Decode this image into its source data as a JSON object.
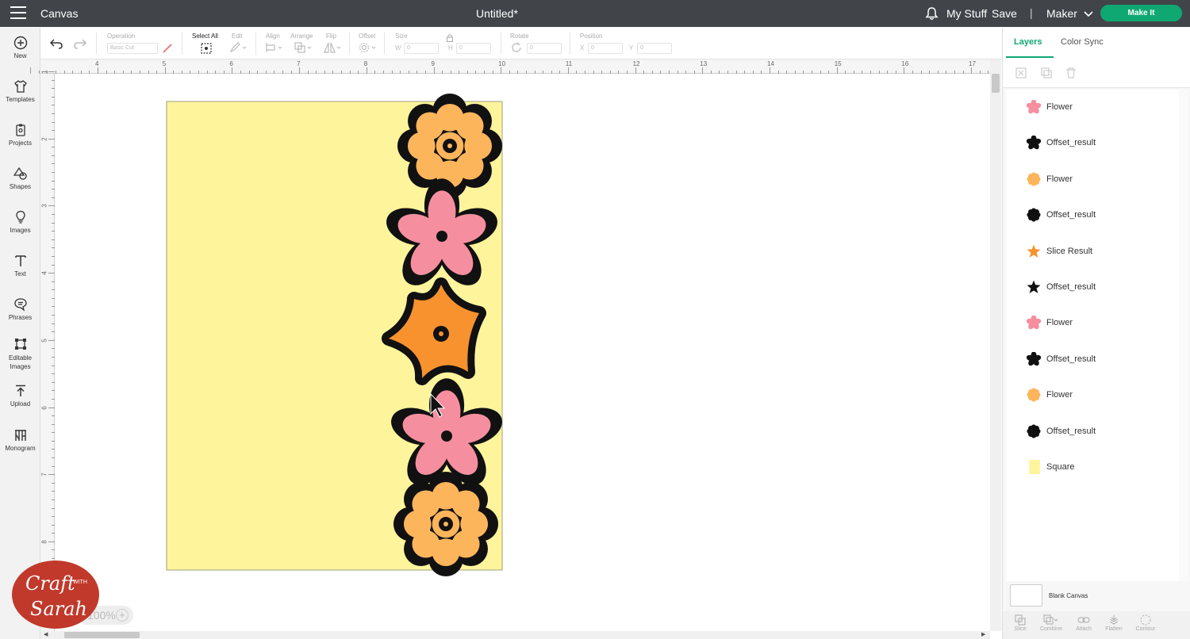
{
  "topbar": {
    "menu_icon": "hamburger-menu-icon",
    "app_title": "Canvas",
    "doc_title": "Untitled*",
    "bell_icon": "bell-icon",
    "my_stuff": "My Stuff",
    "save": "Save",
    "separator": "|",
    "machine": "Maker",
    "make_it": "Make It",
    "accent": "#10a872",
    "bar_color": "#414549"
  },
  "sidebar": {
    "items": [
      {
        "label": "New",
        "icon": "plus-circle-icon"
      },
      {
        "label": "Templates",
        "icon": "shirt-icon"
      },
      {
        "label": "Projects",
        "icon": "clipboard-icon"
      },
      {
        "label": "Shapes",
        "icon": "shapes-icon"
      },
      {
        "label": "Images",
        "icon": "lightbulb-icon"
      },
      {
        "label": "Text",
        "icon": "text-t-icon"
      },
      {
        "label": "Phrases",
        "icon": "speech-bubble-icon"
      },
      {
        "label": "Editable Images",
        "icon": "editable-image-icon"
      },
      {
        "label": "Upload",
        "icon": "upload-arrow-icon"
      },
      {
        "label": "Monogram",
        "icon": "monogram-icon"
      }
    ]
  },
  "toolbar": {
    "operation_label": "Operation",
    "operation_value": "Basic Cut",
    "select_all": "Select All",
    "edit": "Edit",
    "align": "Align",
    "arrange": "Arrange",
    "flip": "Flip",
    "offset": "Offset",
    "size": "Size",
    "size_w": "W",
    "size_w_value": "0",
    "size_h": "H",
    "size_h_value": "0",
    "rotate": "Rotate",
    "rotate_value": "0",
    "position": "Position",
    "pos_x": "X",
    "pos_x_value": "0",
    "pos_y": "Y",
    "pos_y_value": "0"
  },
  "ruler": {
    "top": [
      "4",
      "5",
      "6",
      "7",
      "8",
      "9",
      "10",
      "11",
      "12",
      "13",
      "14",
      "15",
      "16",
      "17"
    ],
    "left": [
      "1",
      "2",
      "3",
      "4",
      "5",
      "6",
      "7",
      "8"
    ]
  },
  "canvas": {
    "background_color": "#fef49c",
    "flower_colors": [
      "#fdb55c",
      "#f58f9f",
      "#f7922e",
      "#f58f9f",
      "#fdb55c"
    ]
  },
  "panel": {
    "tab_layers": "Layers",
    "tab_color_sync": "Color Sync",
    "layers": [
      {
        "name": "Flower",
        "color": "#f58f9f",
        "icon": "flower-icon"
      },
      {
        "name": "Offset_result",
        "color": "#111111",
        "icon": "flower-icon"
      },
      {
        "name": "Flower",
        "color": "#fdb55c",
        "icon": "daisy-icon"
      },
      {
        "name": "Offset_result",
        "color": "#111111",
        "icon": "daisy-icon"
      },
      {
        "name": "Slice Result",
        "color": "#f7922e",
        "icon": "star-flower-icon"
      },
      {
        "name": "Offset_result",
        "color": "#111111",
        "icon": "star-flower-icon"
      },
      {
        "name": "Flower",
        "color": "#f58f9f",
        "icon": "flower-icon"
      },
      {
        "name": "Offset_result",
        "color": "#111111",
        "icon": "flower-icon"
      },
      {
        "name": "Flower",
        "color": "#fdb55c",
        "icon": "daisy-icon"
      },
      {
        "name": "Offset_result",
        "color": "#111111",
        "icon": "daisy-icon"
      },
      {
        "name": "Square",
        "color": "#fef49c",
        "icon": "square-icon"
      }
    ],
    "blank_canvas": "Blank Canvas",
    "bottom_actions": [
      "Slice",
      "Combine",
      "Attach",
      "Flatten",
      "Contour"
    ]
  },
  "zoom": {
    "value": "100%"
  },
  "watermark": {
    "line1": "Craft",
    "with": "WITH",
    "line2": "Sarah"
  }
}
